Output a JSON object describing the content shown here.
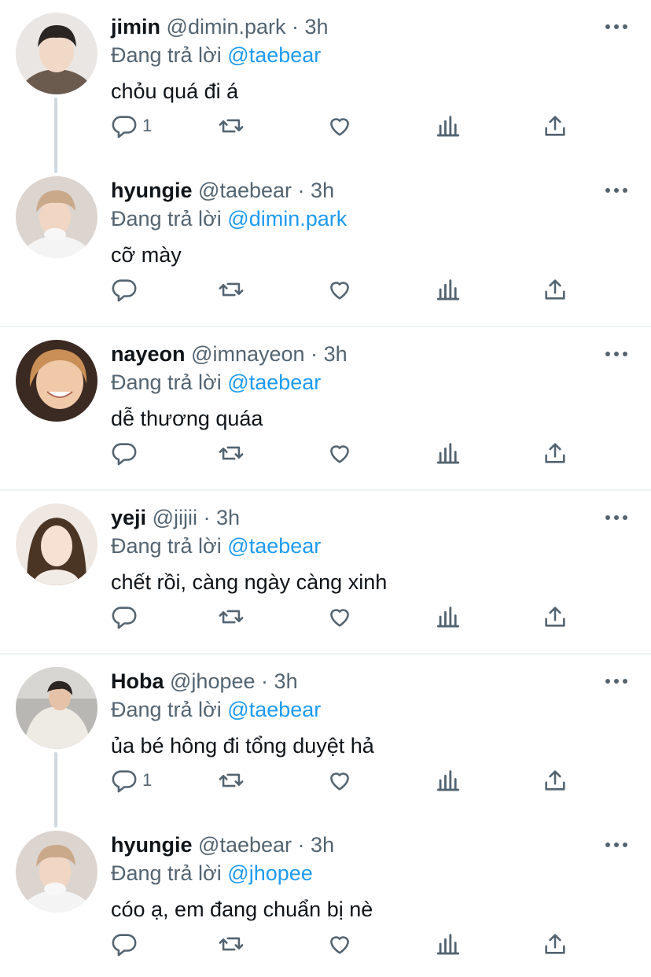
{
  "replying_prefix": "Đang trả lời",
  "colors": {
    "accent": "#1d9bf0",
    "secondary_text": "#536471",
    "icon": "#536471"
  },
  "tweets": [
    {
      "name": "jimin",
      "handle": "@dimin.park",
      "dot": "·",
      "time": "3h",
      "replying_to": "@taebear",
      "text": "chỏu quá đi á",
      "reply_count": "1",
      "avatar": "avatar-jimin"
    },
    {
      "name": "hyungie",
      "handle": "@taebear",
      "dot": "·",
      "time": "3h",
      "replying_to": "@dimin.park",
      "text": "cỡ mày",
      "reply_count": "",
      "avatar": "avatar-hyungie"
    },
    {
      "name": "nayeon",
      "handle": "@imnayeon",
      "dot": "·",
      "time": "3h",
      "replying_to": "@taebear",
      "text": "dễ thương quáa",
      "reply_count": "",
      "avatar": "avatar-nayeon"
    },
    {
      "name": "yeji",
      "handle": "@jijii",
      "dot": "·",
      "time": "3h",
      "replying_to": "@taebear",
      "text": "chết rồi, càng ngày càng xinh",
      "reply_count": "",
      "avatar": "avatar-yeji"
    },
    {
      "name": "Hoba",
      "handle": "@jhopee",
      "dot": "·",
      "time": "3h",
      "replying_to": "@taebear",
      "text": "ủa bé hông đi tổng duyệt hả",
      "reply_count": "1",
      "avatar": "avatar-hoba"
    },
    {
      "name": "hyungie",
      "handle": "@taebear",
      "dot": "·",
      "time": "3h",
      "replying_to": "@jhopee",
      "text": "cóo ạ, em đang chuẩn bị nè",
      "reply_count": "",
      "avatar": "avatar-hyungie"
    }
  ],
  "icons": {
    "reply": "reply-icon",
    "retweet": "retweet-icon",
    "like": "heart-icon",
    "views": "analytics-icon",
    "share": "share-icon",
    "more": "more-icon"
  }
}
